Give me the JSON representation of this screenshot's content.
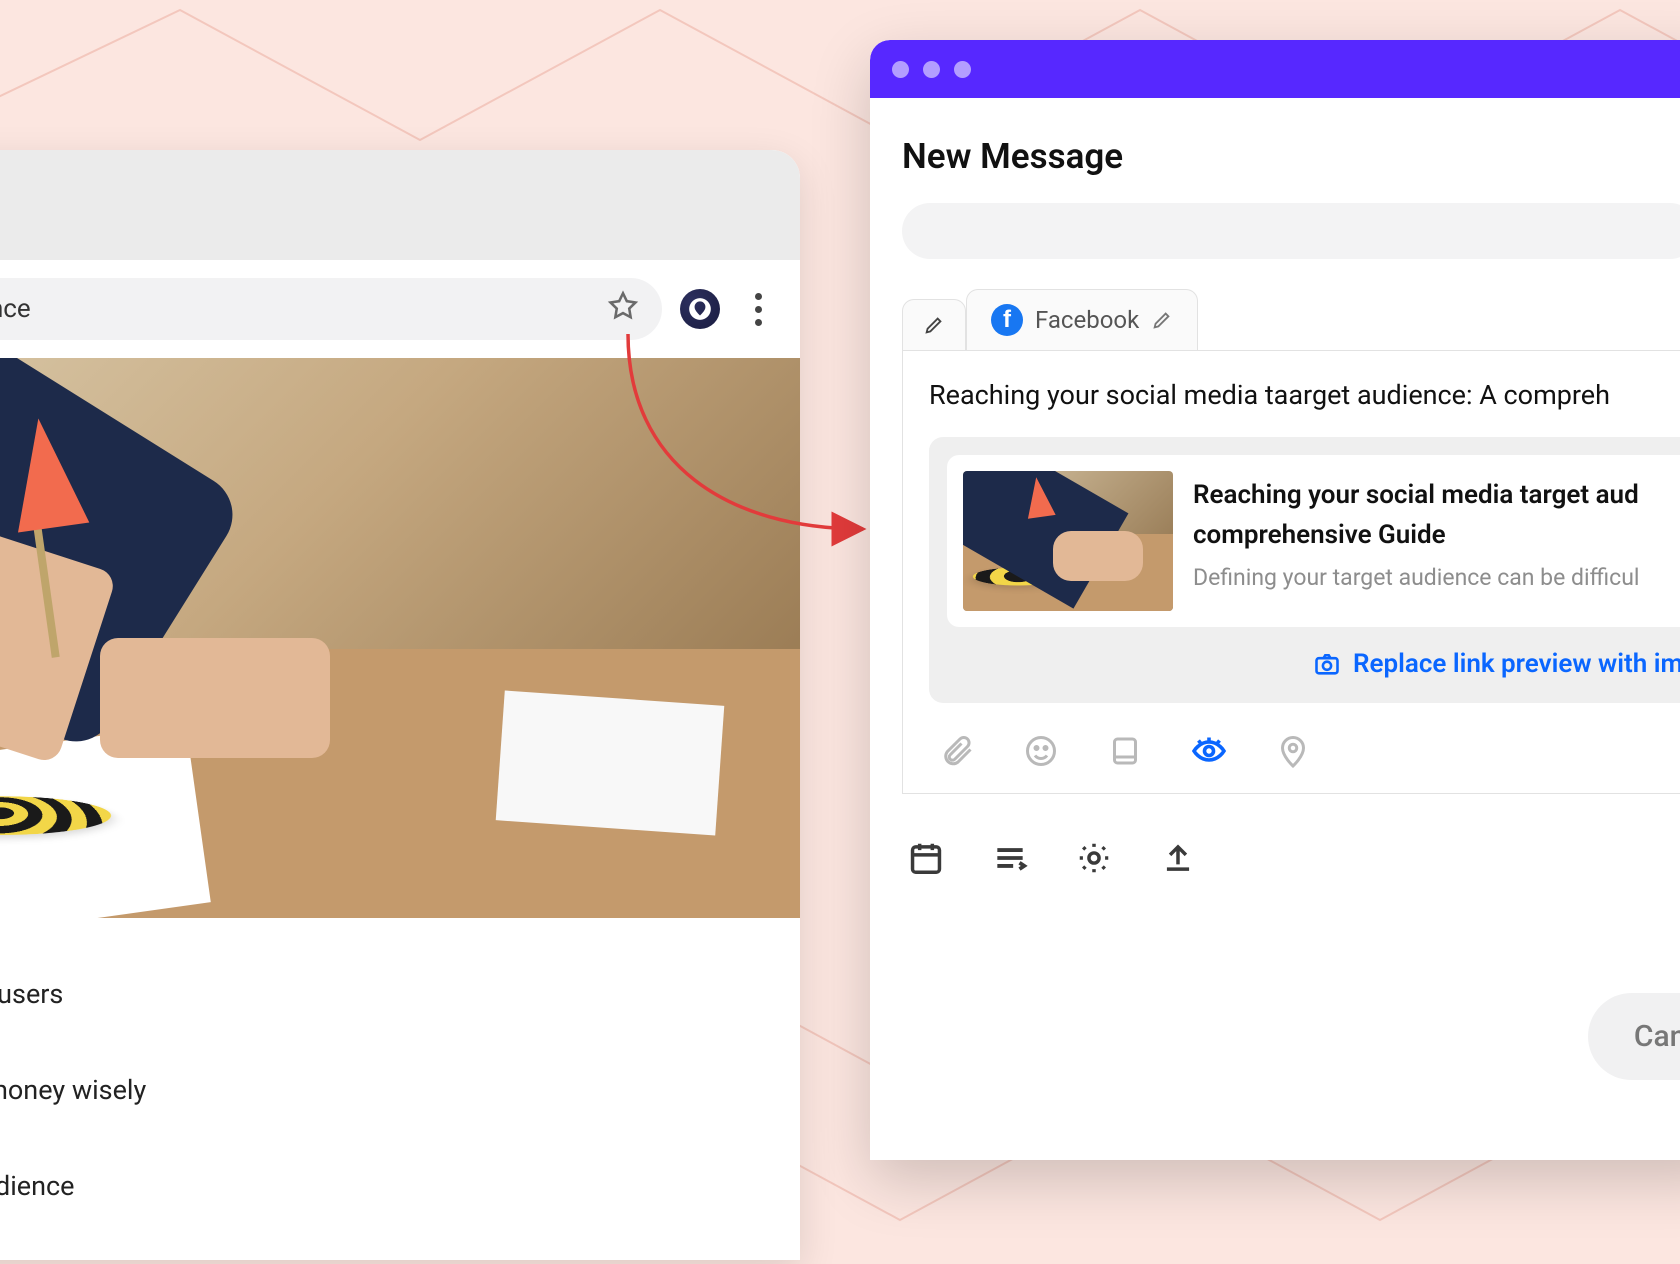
{
  "browser": {
    "url_fragment": "t-audience",
    "article": {
      "lines": [
        "al media users",
        "me and money wisely",
        " target audience"
      ]
    }
  },
  "modal": {
    "title": "New Message",
    "tabs": {
      "facebook_label": "Facebook"
    },
    "compose_text": "Reaching your social media taarget audience: A compreh",
    "preview": {
      "title": "Reaching your social media target aud… comprehensive Guide",
      "title_line1": "Reaching your social media target aud",
      "title_line2": "comprehensive Guide",
      "description": "Defining your target audience can be difficul"
    },
    "replace_link_label": "Replace link preview with ima",
    "cancel_label": "Canc"
  },
  "colors": {
    "accent": "#5728ff",
    "link": "#0a66ff",
    "facebook": "#1877f2"
  }
}
